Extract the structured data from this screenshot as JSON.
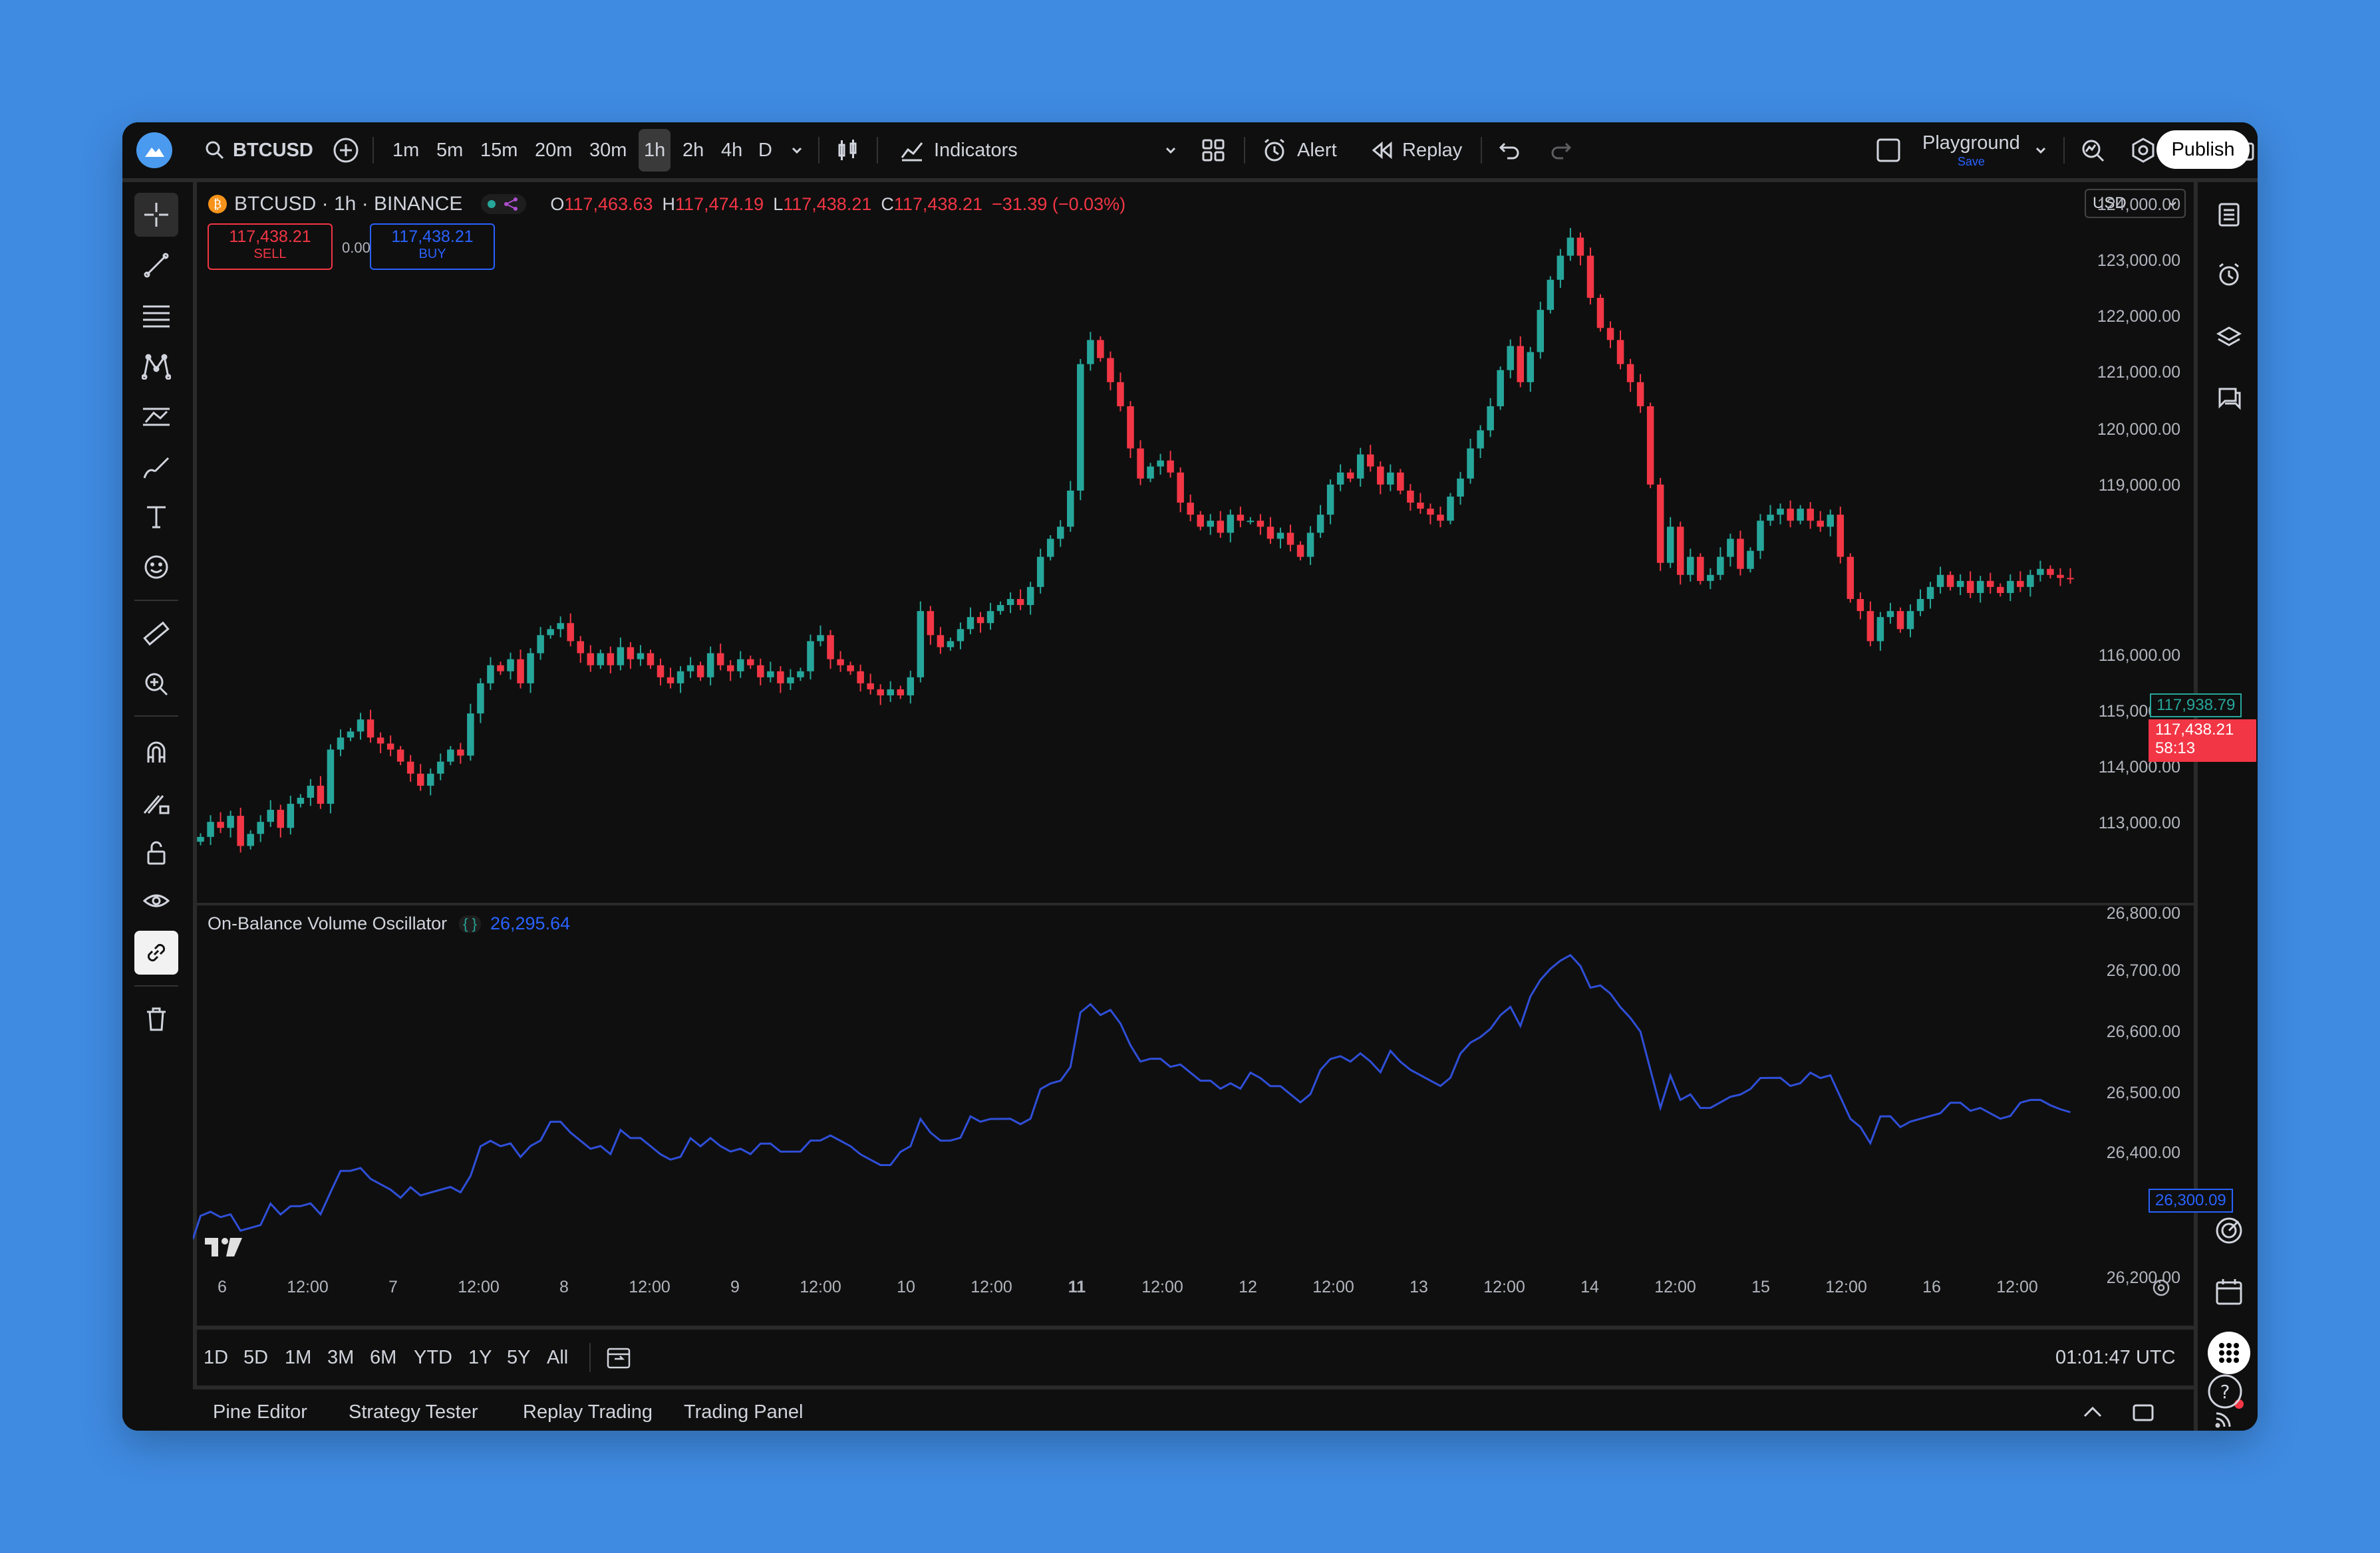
{
  "toolbar": {
    "symbol": "BTCUSD",
    "timeframes": [
      "1m",
      "5m",
      "15m",
      "20m",
      "30m",
      "1h",
      "2h",
      "4h",
      "D"
    ],
    "active_timeframe": "1h",
    "indicators_label": "Indicators",
    "alert_label": "Alert",
    "replay_label": "Replay",
    "layout_name": "Playground",
    "layout_save": "Save",
    "publish_label": "Publish"
  },
  "legend": {
    "title": "BTCUSD · 1h · BINANCE",
    "o_label": "O",
    "o": "117,463.63",
    "h_label": "H",
    "h": "117,474.19",
    "l_label": "L",
    "l": "117,438.21",
    "c_label": "C",
    "c": "117,438.21",
    "change": "−31.39 (−0.03%)"
  },
  "trade": {
    "sell_price": "117,438.21",
    "sell_label": "SELL",
    "spread": "0.00",
    "buy_price": "117,438.21",
    "buy_label": "BUY"
  },
  "currency": "USD",
  "price_axis": [
    "124,000.00",
    "123,000.00",
    "122,000.00",
    "121,000.00",
    "120,000.00",
    "119,000.00",
    "116,000.00",
    "115,000.00",
    "114,000.00",
    "113,000.00"
  ],
  "price_tags": {
    "green": "117,938.79",
    "red": "117,438.21",
    "countdown": "58:13"
  },
  "oscillator": {
    "name": "On-Balance Volume Oscillator",
    "value": "26,295.64",
    "axis": [
      "26,800.00",
      "26,700.00",
      "26,600.00",
      "26,500.00",
      "26,400.00",
      "26,200.00"
    ],
    "current_tag": "26,300.09"
  },
  "time_axis": [
    "6",
    "12:00",
    "7",
    "12:00",
    "8",
    "12:00",
    "9",
    "12:00",
    "10",
    "12:00",
    "11",
    "12:00",
    "12",
    "12:00",
    "13",
    "12:00",
    "14",
    "12:00",
    "15",
    "12:00",
    "16",
    "12:00"
  ],
  "ranges": [
    "1D",
    "5D",
    "1M",
    "3M",
    "6M",
    "YTD",
    "1Y",
    "5Y",
    "All"
  ],
  "clock": "01:01:47 UTC",
  "footer_tabs": [
    "Pine Editor",
    "Strategy Tester",
    "Replay Trading",
    "Trading Panel"
  ],
  "colors": {
    "up": "#26a69a",
    "down": "#f23645",
    "obv": "#2f4fd8",
    "background": "#0f0f0f"
  },
  "chart_data": {
    "type": "candlestick",
    "ylim": [
      112600,
      124300
    ],
    "closes": [
      113650,
      113900,
      113800,
      114000,
      113500,
      113700,
      113900,
      114100,
      113800,
      114200,
      114300,
      114500,
      114200,
      115100,
      115300,
      115400,
      115600,
      115300,
      115200,
      115100,
      114900,
      114700,
      114500,
      114700,
      114900,
      115100,
      115000,
      115700,
      116200,
      116500,
      116400,
      116600,
      116200,
      116700,
      117000,
      117100,
      117200,
      116900,
      116700,
      116500,
      116700,
      116500,
      116800,
      116600,
      116700,
      116500,
      116300,
      116200,
      116400,
      116500,
      116300,
      116700,
      116500,
      116400,
      116600,
      116500,
      116300,
      116400,
      116200,
      116300,
      116400,
      116900,
      117000,
      116600,
      116500,
      116400,
      116200,
      116100,
      116000,
      116100,
      116000,
      116300,
      117400,
      117000,
      116800,
      116900,
      117100,
      117300,
      117200,
      117400,
      117500,
      117600,
      117500,
      117800,
      118300,
      118600,
      118800,
      119400,
      121500,
      121900,
      121600,
      121200,
      120800,
      120100,
      119600,
      119800,
      119900,
      119700,
      119200,
      119000,
      118800,
      118900,
      118700,
      119000,
      118900,
      118900,
      118800,
      118600,
      118700,
      118500,
      118300,
      118700,
      119000,
      119500,
      119700,
      119600,
      120000,
      119800,
      119500,
      119700,
      119400,
      119200,
      119100,
      119000,
      118900,
      119300,
      119600,
      120100,
      120400,
      120800,
      121400,
      121800,
      121200,
      121700,
      122400,
      122900,
      123300,
      123600,
      123300,
      122600,
      122100,
      121900,
      121500,
      121200,
      120800,
      119500,
      118200,
      118800,
      118000,
      118300,
      117900,
      118000,
      118300,
      118600,
      118100,
      118400,
      118900,
      119000,
      119100,
      118900,
      119100,
      118900,
      118800,
      119000,
      118300,
      117600,
      117400,
      116900,
      117300,
      117400,
      117100,
      117400,
      117600,
      117800,
      118000,
      117800,
      117900,
      117700,
      117900,
      117800,
      117700,
      117900,
      117800,
      118000,
      118100,
      118000,
      117950,
      117938
    ]
  }
}
